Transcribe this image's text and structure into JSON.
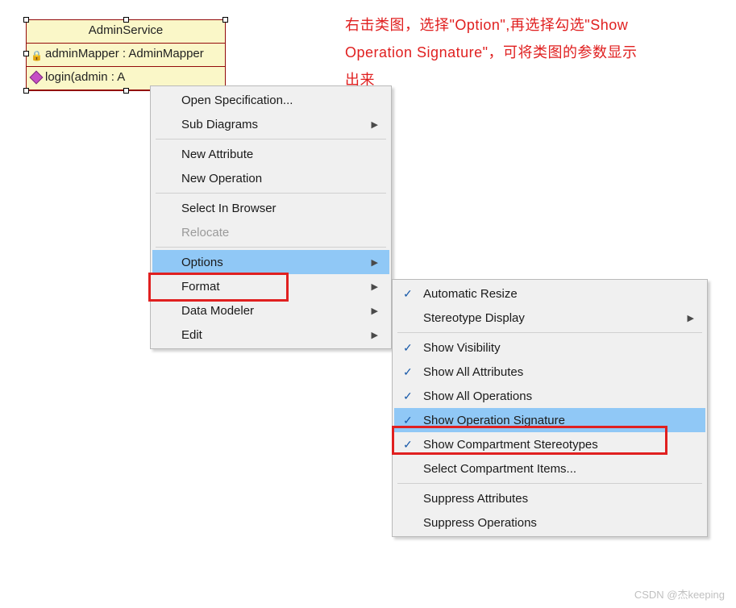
{
  "uml": {
    "title": "AdminService",
    "attribute": "adminMapper : AdminMapper",
    "operation": "login(admin : A"
  },
  "annotation": {
    "line1": "右击类图，选择\"Option\",再选择勾选\"Show",
    "line2": "Operation Signature\"，可将类图的参数显示",
    "line3": "出来"
  },
  "menu1": {
    "openSpec": "Open Specification...",
    "subDiagrams": "Sub Diagrams",
    "newAttribute": "New Attribute",
    "newOperation": "New Operation",
    "selectInBrowser": "Select In Browser",
    "relocate": "Relocate",
    "options": "Options",
    "format": "Format",
    "dataModeler": "Data Modeler",
    "edit": "Edit"
  },
  "menu2": {
    "autoResize": "Automatic Resize",
    "stereoDisplay": "Stereotype Display",
    "showVisibility": "Show Visibility",
    "showAllAttrs": "Show All Attributes",
    "showAllOps": "Show All Operations",
    "showOpSig": "Show Operation Signature",
    "showCompStereo": "Show Compartment Stereotypes",
    "selectCompItems": "Select Compartment Items...",
    "suppressAttrs": "Suppress Attributes",
    "suppressOps": "Suppress Operations"
  },
  "watermark": "CSDN @杰keeping"
}
